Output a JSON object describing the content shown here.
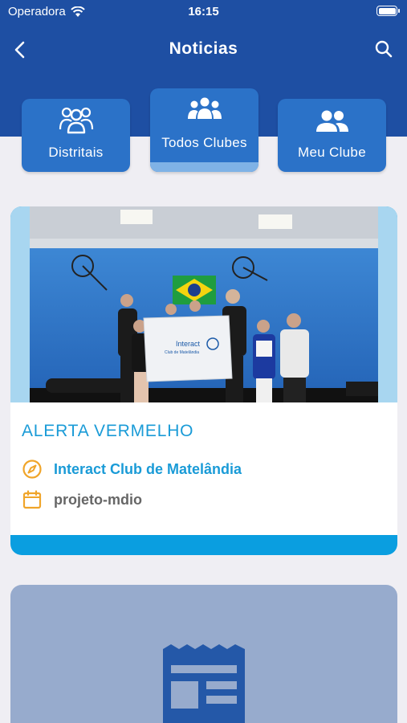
{
  "status_bar": {
    "carrier": "Operadora",
    "time": "16:15"
  },
  "nav": {
    "title": "Noticias",
    "back_icon": "chevron-left-icon",
    "search_icon": "search-icon"
  },
  "tabs": [
    {
      "label": "Distritais",
      "icon": "group-outline-icon",
      "active": false
    },
    {
      "label": "Todos Clubes",
      "icon": "group-three-icon",
      "active": true
    },
    {
      "label": "Meu Clube",
      "icon": "group-two-icon",
      "active": false
    }
  ],
  "news": [
    {
      "title": "ALERTA VERMELHO",
      "club": "Interact Club de Matelândia",
      "category": "projeto-mdio",
      "club_icon": "compass-icon",
      "category_icon": "calendar-icon",
      "banner": {
        "line1": "Interact",
        "line2": "Club de Matelândia"
      }
    },
    {
      "title": "",
      "placeholder_icon": "newspaper-icon"
    }
  ],
  "colors": {
    "header": "#1e4fa3",
    "tab": "#2b72c8",
    "accent": "#1a9bd7",
    "card_strip": "#0a9ee0",
    "icon_orange": "#f0a52a",
    "placeholder_card": "#97abcd"
  }
}
